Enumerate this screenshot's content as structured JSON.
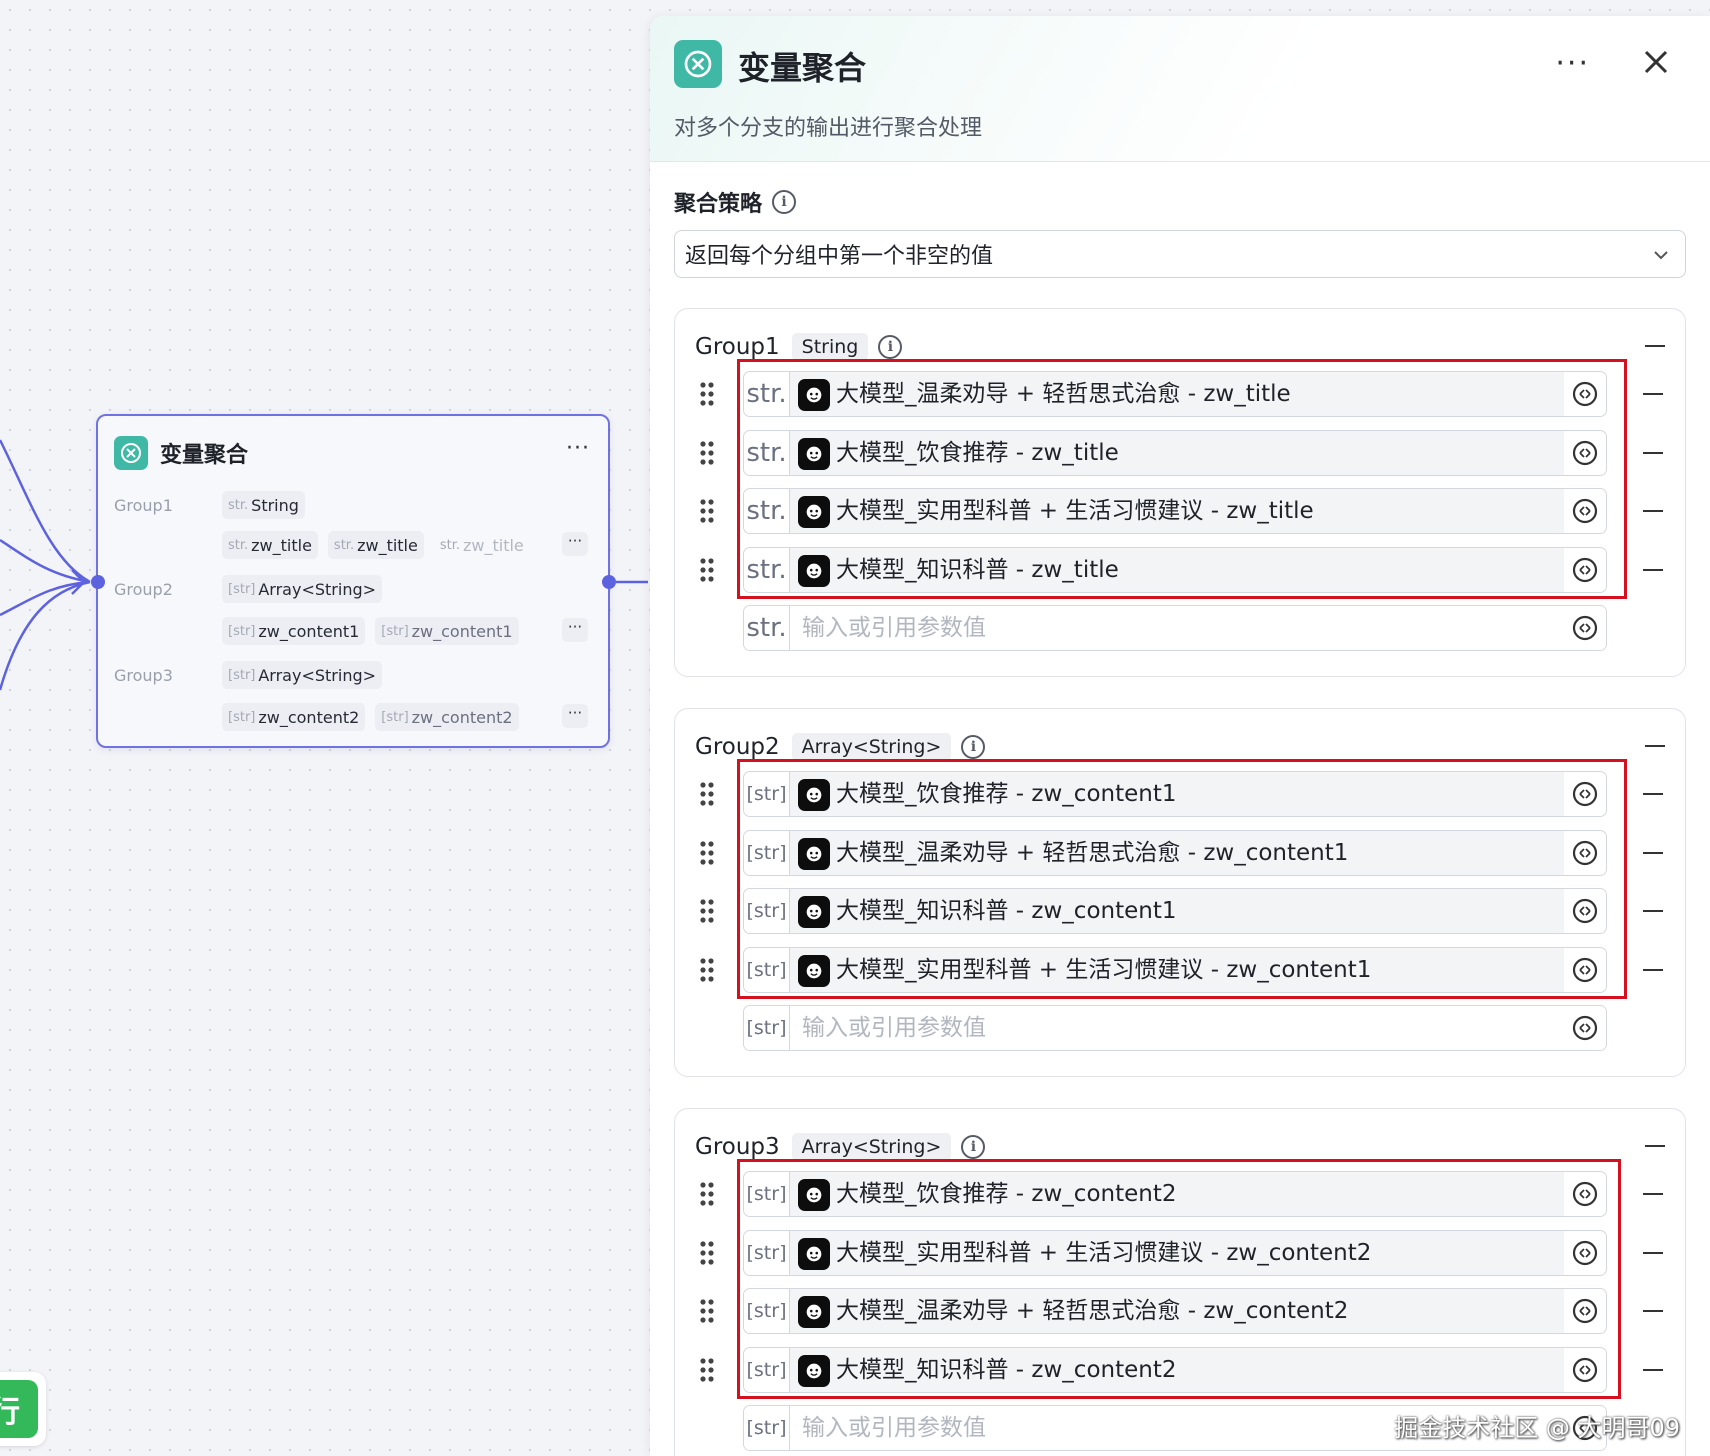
{
  "canvas": {
    "node": {
      "title": "变量聚合",
      "more_label": "···",
      "groups": [
        {
          "label": "Group1",
          "type_prefix": "str.",
          "type": "String",
          "items": [
            {
              "prefix": "str.",
              "name": "zw_title"
            },
            {
              "prefix": "str.",
              "name": "zw_title"
            },
            {
              "prefix": "str.",
              "name": "zw_title"
            }
          ],
          "more_label": "···"
        },
        {
          "label": "Group2",
          "type_prefix": "[str]",
          "type": "Array<String>",
          "items": [
            {
              "prefix": "[str]",
              "name": "zw_content1"
            },
            {
              "prefix": "[str]",
              "name": "zw_content1"
            }
          ],
          "more_label": "···"
        },
        {
          "label": "Group3",
          "type_prefix": "[str]",
          "type": "Array<String>",
          "items": [
            {
              "prefix": "[str]",
              "name": "zw_content2"
            },
            {
              "prefix": "[str]",
              "name": "zw_content2"
            }
          ],
          "more_label": "···"
        }
      ]
    },
    "run_button_label": "行"
  },
  "panel": {
    "title": "变量聚合",
    "more_label": "···",
    "description": "对多个分支的输出进行聚合处理",
    "strategy_label": "聚合策略",
    "strategy_value": "返回每个分组中第一个非空的值",
    "groups": [
      {
        "name": "Group1",
        "type": "String",
        "type_badge": "str.",
        "placeholder": "输入或引用参数值",
        "vars": [
          "大模型_温柔劝导 + 轻哲思式治愈 - zw_title",
          "大模型_饮食推荐 - zw_title",
          "大模型_实用型科普 + 生活习惯建议 - zw_title",
          "大模型_知识科普 - zw_title"
        ]
      },
      {
        "name": "Group2",
        "type": "Array<String>",
        "type_badge": "[str]",
        "placeholder": "输入或引用参数值",
        "vars": [
          "大模型_饮食推荐 - zw_content1",
          "大模型_温柔劝导 + 轻哲思式治愈 - zw_content1",
          "大模型_知识科普 - zw_content1",
          "大模型_实用型科普 + 生活习惯建议 - zw_content1"
        ]
      },
      {
        "name": "Group3",
        "type": "Array<String>",
        "type_badge": "[str]",
        "placeholder": "输入或引用参数值",
        "vars": [
          "大模型_饮食推荐 - zw_content2",
          "大模型_实用型科普 + 生活习惯建议 - zw_content2",
          "大模型_温柔劝导 + 轻哲思式治愈 - zw_content2",
          "大模型_知识科普 - zw_content2"
        ]
      }
    ]
  },
  "watermark": "掘金技术社区 @ 大明哥09",
  "colors": {
    "accent": "#5d62de",
    "brand_teal": "#3fb9a5",
    "highlight_red": "#d4121f"
  }
}
